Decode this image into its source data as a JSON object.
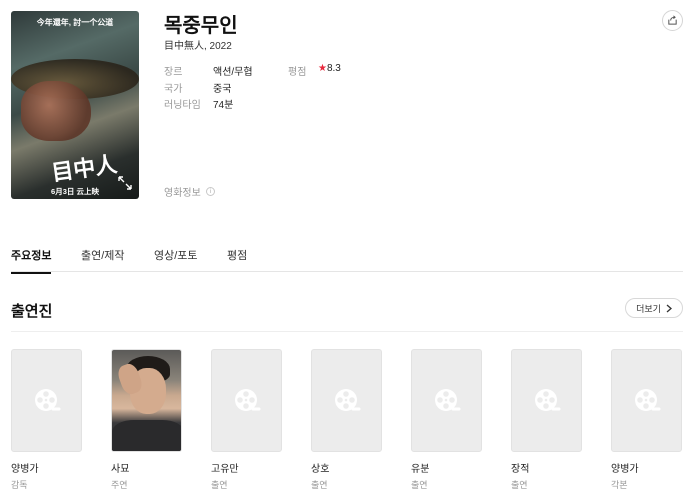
{
  "movie": {
    "title": "목중무인",
    "subtitle": "目中無人, 2022",
    "poster_tagline": "今年還年, 討一个公道",
    "poster_title": "目中人",
    "poster_release": "6月3日 云上映"
  },
  "info": {
    "genre_label": "장르",
    "genre_value": "액션/무협",
    "rating_label": "평점",
    "rating_value": "8.3",
    "country_label": "국가",
    "country_value": "중국",
    "runtime_label": "러닝타임",
    "runtime_value": "74분",
    "movie_info_label": "영화정보",
    "movie_info_icon": "i"
  },
  "tabs": [
    {
      "label": "주요정보",
      "active": true
    },
    {
      "label": "출연/제작",
      "active": false
    },
    {
      "label": "영상/포토",
      "active": false
    },
    {
      "label": "평점",
      "active": false
    }
  ],
  "cast_section": {
    "title": "출연진",
    "more_label": "더보기",
    "members": [
      {
        "name": "양병가",
        "role": "감독",
        "has_photo": false
      },
      {
        "name": "사묘",
        "role": "주연",
        "has_photo": true
      },
      {
        "name": "고유만",
        "role": "출연",
        "has_photo": false
      },
      {
        "name": "상호",
        "role": "출연",
        "has_photo": false
      },
      {
        "name": "유분",
        "role": "출연",
        "has_photo": false
      },
      {
        "name": "장적",
        "role": "출연",
        "has_photo": false
      },
      {
        "name": "양병가",
        "role": "각본",
        "has_photo": false
      }
    ]
  },
  "colors": {
    "rating_star": "#e8293d",
    "placeholder_bg": "#ececec",
    "placeholder_icon": "#ffffff"
  }
}
